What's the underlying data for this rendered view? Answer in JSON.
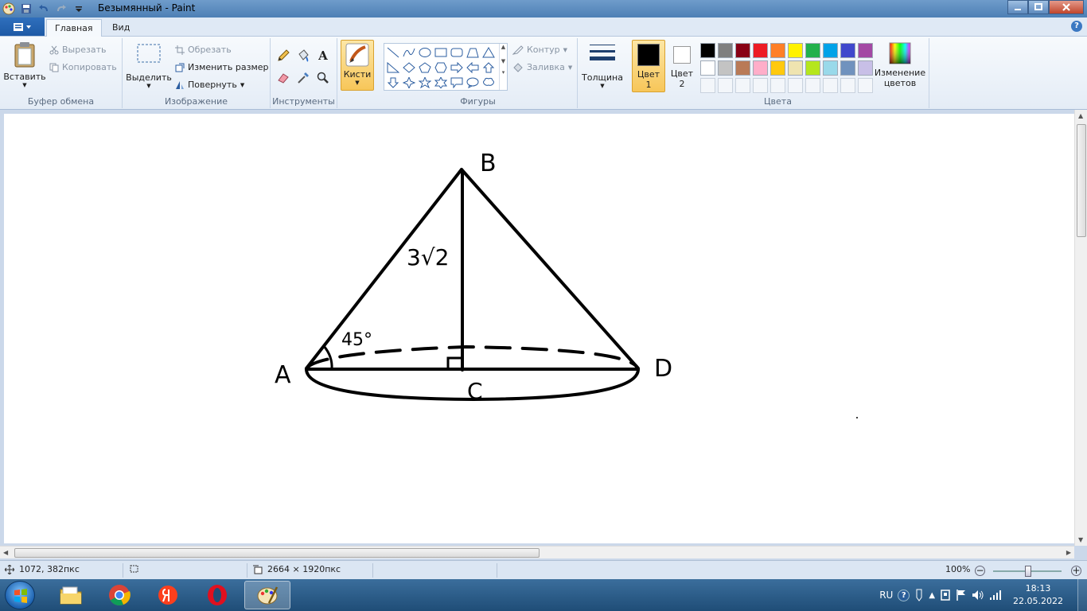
{
  "window": {
    "title": "Безымянный - Paint"
  },
  "tabs": [
    {
      "label": "Главная"
    },
    {
      "label": "Вид"
    }
  ],
  "clipboard": {
    "paste": "Вставить",
    "cut": "Вырезать",
    "copy": "Копировать",
    "group_label": "Буфер обмена"
  },
  "image": {
    "select": "Выделить",
    "crop": "Обрезать",
    "resize": "Изменить размер",
    "rotate": "Повернуть",
    "group_label": "Изображение"
  },
  "tools": {
    "group_label": "Инструменты"
  },
  "brushes": {
    "label": "Кисти"
  },
  "shapes": {
    "outline": "Контур",
    "fill": "Заливка",
    "group_label": "Фигуры"
  },
  "size": {
    "label": "Толщина"
  },
  "colors": {
    "color1": "Цвет 1",
    "color2": "Цвет 2",
    "edit": "Изменение цветов",
    "group_label": "Цвета",
    "color1_value": "#000000",
    "color2_value": "#ffffff",
    "palette_row1": [
      "#000000",
      "#7f7f7f",
      "#880015",
      "#ed1c24",
      "#ff7f27",
      "#fff200",
      "#22b14c",
      "#00a2e8",
      "#3f48cc",
      "#a349a4"
    ],
    "palette_row2": [
      "#ffffff",
      "#c3c3c3",
      "#b97a57",
      "#ffaec9",
      "#ffc90e",
      "#efe4b0",
      "#b5e61d",
      "#99d9ea",
      "#7092be",
      "#c8bfe7"
    ]
  },
  "drawing": {
    "label_a": "A",
    "label_b": "B",
    "label_c": "C",
    "label_d": "D",
    "label_height": "3√2",
    "label_angle": "45°"
  },
  "status": {
    "cursor_pos": "1072, 382пкс",
    "image_size": "2664 × 1920пкс",
    "zoom": "100%"
  },
  "taskbar": {
    "lang": "RU",
    "time": "18:13",
    "date": "22.05.2022"
  }
}
